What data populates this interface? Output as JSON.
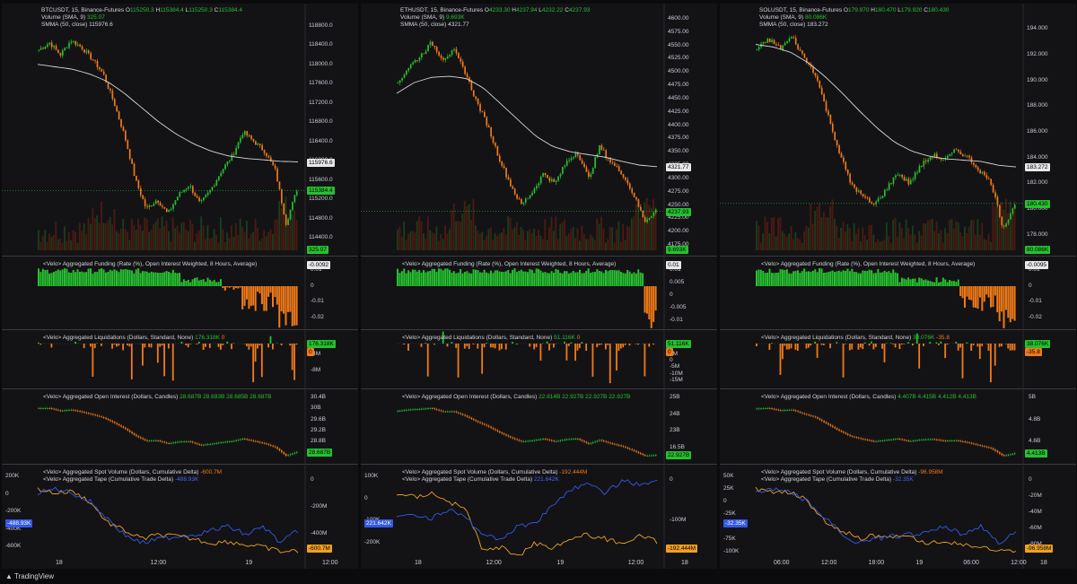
{
  "app": {
    "brand": "TradingView"
  },
  "colors": {
    "up": "#26c030",
    "down": "#f07a18",
    "smma": "#d8d8d8",
    "spot": "#f0a020",
    "tape": "#3458e8",
    "bg": "#131316"
  },
  "panels": [
    {
      "symbol_line": "BTCUSDT, 15, Binance-Futures",
      "ohlc": {
        "O": "115250.3",
        "H": "115384.4",
        "L": "115250.3",
        "C": "115384.4"
      },
      "volume_line": "Volume (SMA, 9)",
      "volume_val": "325.07",
      "smma_line": "SMMA (50, close)",
      "smma_val": "115976.6",
      "price_ticks": [
        "118800.0",
        "118400.0",
        "118000.0",
        "117600.0",
        "117200.0",
        "116800.0",
        "116400.0",
        "116000.0",
        "115600.0",
        "115200.0",
        "114800.0",
        "114400.0"
      ],
      "last_price": "115384.4",
      "smma_tag": "115976.6",
      "vol_tag": "325.07",
      "funding_title": "<Velo> Aggregated Funding (Rate (%), Open Interest Weighted, 8 Hours, Average)",
      "funding_val": "-0.0092",
      "funding_ticks": [
        "0.01",
        "0",
        "-0.01",
        "-0.02"
      ],
      "funding_tag": "-0.0092",
      "liq_title": "<Velo> Aggregated Liquidations (Dollars, Standard, None)",
      "liq_vals": [
        "176.318K",
        "0"
      ],
      "liq_ticks": [
        "-4M",
        "-8M"
      ],
      "liq_tags": [
        "176.318K",
        "0"
      ],
      "oi_title": "<Velo> Aggregated Open Interest (Dollars, Candles)",
      "oi_vals": "28.687B 28.693B 28.685B 28.687B",
      "oi_ticks": [
        "30.4B",
        "30B",
        "29.6B",
        "29.2B",
        "28.8B",
        "28.4B"
      ],
      "oi_tag": "28.687B",
      "spot_title": "<Velo> Aggregated Spot Volume (Dollars, Cumulative Delta)",
      "spot_val": "-600.7M",
      "tape_title": "<Velo> Aggregated Tape (Cumulative Trade Delta)",
      "tape_val": "-488.93K",
      "left_ticks": [
        "200K",
        "0",
        "-200K",
        "-400K",
        "-600K"
      ],
      "right_ticks": [
        "0",
        "-200M",
        "-400M"
      ],
      "tape_tag": "-488.93K",
      "spot_tag": "-600.7M",
      "x_labels": [
        "18",
        "12:00",
        "19",
        "12:00"
      ]
    },
    {
      "symbol_line": "ETHUSDT, 15, Binance-Futures",
      "ohlc": {
        "O": "4233.30",
        "H": "4237.94",
        "L": "4232.22",
        "C": "4237.93"
      },
      "volume_line": "Volume (SMA, 9)",
      "volume_val": "9.693K",
      "smma_line": "SMMA (50, close)",
      "smma_val": "4321.77",
      "price_ticks": [
        "4600.00",
        "4575.00",
        "4550.00",
        "4525.00",
        "4500.00",
        "4475.00",
        "4450.00",
        "4425.00",
        "4400.00",
        "4375.00",
        "4350.00",
        "4325.00",
        "4300.00",
        "4275.00",
        "4250.00",
        "4225.00",
        "4200.00",
        "4175.00"
      ],
      "last_price": "4237.93",
      "smma_tag": "4321.77",
      "vol_tag": "9.693K",
      "funding_title": "<Velo> Aggregated Funding (Rate (%), Open Interest Weighted, 8 Hours, Average)",
      "funding_val": "0.01",
      "funding_ticks": [
        "0.01",
        "0.005",
        "0",
        "-0.005",
        "-0.01"
      ],
      "funding_tag": "0.01",
      "liq_title": "<Velo> Aggregated Liquidations (Dollars, Standard, None)",
      "liq_vals": [
        "51.116K",
        "0"
      ],
      "liq_ticks": [
        "5M",
        "0",
        "-5M",
        "-10M",
        "-15M"
      ],
      "liq_tags": [
        "51.116K",
        "0"
      ],
      "oi_title": "<Velo> Aggregated Open Interest (Dollars, Candles)",
      "oi_vals": "22.914B 22.927B 22.927B 22.927B",
      "oi_ticks": [
        "25B",
        "24B",
        "23B",
        "16.5B"
      ],
      "oi_tag": "22.927B",
      "spot_title": "<Velo> Aggregated Spot Volume (Dollars, Cumulative Delta)",
      "spot_val": "-192.444M",
      "tape_title": "<Velo> Aggregated Tape (Cumulative Trade Delta)",
      "tape_val": "221.642K",
      "left_ticks": [
        "100K",
        "0",
        "-100K",
        "-200K"
      ],
      "right_ticks": [
        "0",
        "-100M"
      ],
      "tape_tag": "221.642K",
      "spot_tag": "-192.444M",
      "x_labels": [
        "18",
        "12:00",
        "19",
        "12:00",
        "18"
      ]
    },
    {
      "symbol_line": "SOLUSDT, 15, Binance-Futures",
      "ohlc": {
        "O": "179.970",
        "H": "180.470",
        "L": "179.920",
        "C": "180.430"
      },
      "volume_line": "Volume (SMA, 9)",
      "volume_val": "80.086K",
      "smma_line": "SMMA (50, close)",
      "smma_val": "183.272",
      "price_ticks": [
        "194.000",
        "192.000",
        "190.000",
        "188.000",
        "186.000",
        "184.000",
        "182.000",
        "180.000",
        "178.000"
      ],
      "last_price": "180.430",
      "smma_tag": "183.272",
      "vol_tag": "80.086K",
      "funding_title": "<Velo> Aggregated Funding (Rate (%), Open Interest Weighted, 8 Hours, Average)",
      "funding_val": "-0.0095",
      "funding_ticks": [
        "0.01",
        "0",
        "-0.01",
        "-0.02"
      ],
      "funding_tag": "-0.0095",
      "liq_title": "<Velo> Aggregated Liquidations (Dollars, Standard, None)",
      "liq_vals": [
        "38.076K",
        "-35.8"
      ],
      "liq_ticks": [
        "-2M"
      ],
      "liq_tags": [
        "38.076K",
        "-35.8"
      ],
      "oi_title": "<Velo> Aggregated Open Interest (Dollars, Candles)",
      "oi_vals": "4.407B 4.415B 4.412B 4.413B",
      "oi_ticks": [
        "5B",
        "4.8B",
        "4.6B"
      ],
      "oi_tag": "4.413B",
      "spot_title": "<Velo> Aggregated Spot Volume (Dollars, Cumulative Delta)",
      "spot_val": "-96.958M",
      "tape_title": "<Velo> Aggregated Tape (Cumulative Trade Delta)",
      "tape_val": "-32.35K",
      "left_ticks": [
        "50K",
        "25K",
        "0",
        "-25K",
        "-50K",
        "-75K",
        "-100K"
      ],
      "right_ticks": [
        "0",
        "-20M",
        "-40M",
        "-60M",
        "-80M"
      ],
      "tape_tag": "-32.35K",
      "spot_tag": "-96.958M",
      "x_labels": [
        "06:00",
        "12:00",
        "18:00",
        "19",
        "06:00",
        "12:00",
        "18"
      ]
    }
  ],
  "chart_data": [
    {
      "type": "candlestick",
      "title": "BTCUSDT, 15, Binance-Futures",
      "ylim": [
        114200,
        119000
      ],
      "price_path": [
        118300,
        118450,
        118200,
        118500,
        118350,
        118100,
        117800,
        117200,
        116500,
        115600,
        115000,
        115200,
        114900,
        115300,
        115500,
        115100,
        115400,
        115800,
        116100,
        116600,
        116400,
        116200,
        115800,
        114700,
        115400
      ],
      "smma_path": [
        118000,
        117950,
        117900,
        117800,
        117650,
        117400,
        117100,
        116800,
        116550,
        116350,
        116200,
        116100,
        116050,
        116020,
        115990,
        115977
      ],
      "last": 115384.4,
      "smma": 115976.6
    },
    {
      "type": "candlestick",
      "title": "ETHUSDT, 15, Binance-Futures",
      "ylim": [
        4170,
        4605
      ],
      "price_path": [
        4480,
        4510,
        4530,
        4555,
        4525,
        4540,
        4500,
        4445,
        4400,
        4340,
        4290,
        4250,
        4275,
        4310,
        4290,
        4330,
        4350,
        4300,
        4360,
        4330,
        4310,
        4270,
        4220,
        4240
      ],
      "smma_path": [
        4460,
        4480,
        4490,
        4492,
        4488,
        4470,
        4440,
        4410,
        4380,
        4360,
        4350,
        4345,
        4340,
        4332,
        4325,
        4322
      ],
      "last": 4237.93,
      "smma": 4321.77
    },
    {
      "type": "candlestick",
      "title": "SOLUSDT, 15, Binance-Futures",
      "ylim": [
        177,
        195
      ],
      "price_path": [
        192.4,
        193.2,
        192.5,
        193.4,
        191.8,
        190.5,
        187.5,
        184.5,
        182.0,
        181.0,
        180.3,
        181.5,
        182.8,
        182.0,
        183.4,
        184.2,
        183.8,
        184.6,
        184.0,
        183.0,
        182.0,
        178.5,
        180.4
      ],
      "smma_path": [
        192.8,
        192.6,
        192.2,
        191.4,
        190.3,
        189.0,
        187.6,
        186.3,
        185.2,
        184.5,
        184.1,
        183.9,
        183.8,
        183.7,
        183.4,
        183.27
      ],
      "last": 180.43,
      "smma": 183.272
    }
  ]
}
